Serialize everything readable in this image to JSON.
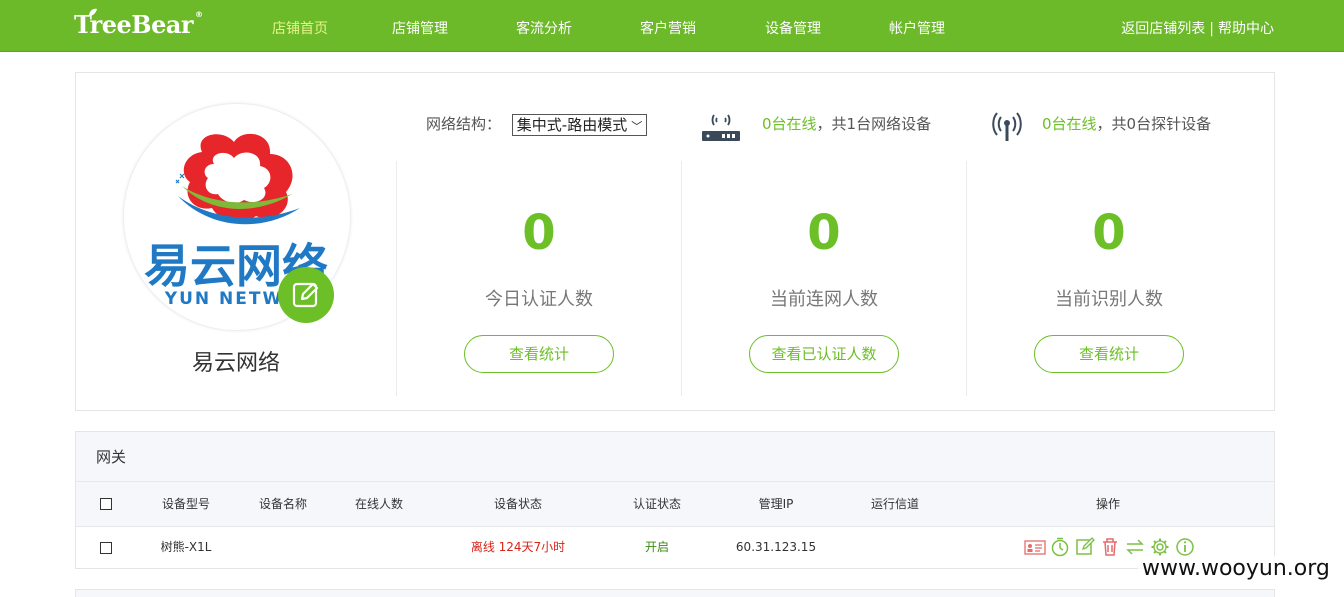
{
  "brand": {
    "logo_text": "TreeBear",
    "reg_mark": "®"
  },
  "nav": {
    "items": [
      "店铺首页",
      "店铺管理",
      "客流分析",
      "客户营销",
      "设备管理",
      "帐户管理"
    ],
    "active_index": 0,
    "right_links": [
      "返回店铺列表",
      "帮助中心"
    ],
    "right_separator": "|"
  },
  "store": {
    "logo_cn": "易云网络",
    "logo_en": "YUN NETW",
    "name": "易云网络"
  },
  "network": {
    "label": "网络结构：",
    "selected": "集中式-路由模式",
    "router_online": "0台在线",
    "router_total": "，共1台网络设备",
    "probe_online": "0台在线",
    "probe_total": "，共0台探针设备"
  },
  "stats": [
    {
      "value": "0",
      "label": "今日认证人数",
      "button": "查看统计"
    },
    {
      "value": "0",
      "label": "当前连网人数",
      "button": "查看已认证人数"
    },
    {
      "value": "0",
      "label": "当前识别人数",
      "button": "查看统计"
    }
  ],
  "gateway": {
    "title": "网关",
    "columns": [
      "设备型号",
      "设备名称",
      "在线人数",
      "设备状态",
      "认证状态",
      "管理IP",
      "运行信道",
      "操作"
    ],
    "rows": [
      {
        "model": "树熊-X1L",
        "name": "",
        "online": "",
        "status": "离线 124天7小时",
        "auth": "开启",
        "ip": "60.31.123.15",
        "channel": ""
      }
    ]
  },
  "colors": {
    "brand_green": "#6cb92a",
    "accent_green": "#6cbf26",
    "offline_red": "#d9241a"
  },
  "watermark": "www.wooyun.org"
}
